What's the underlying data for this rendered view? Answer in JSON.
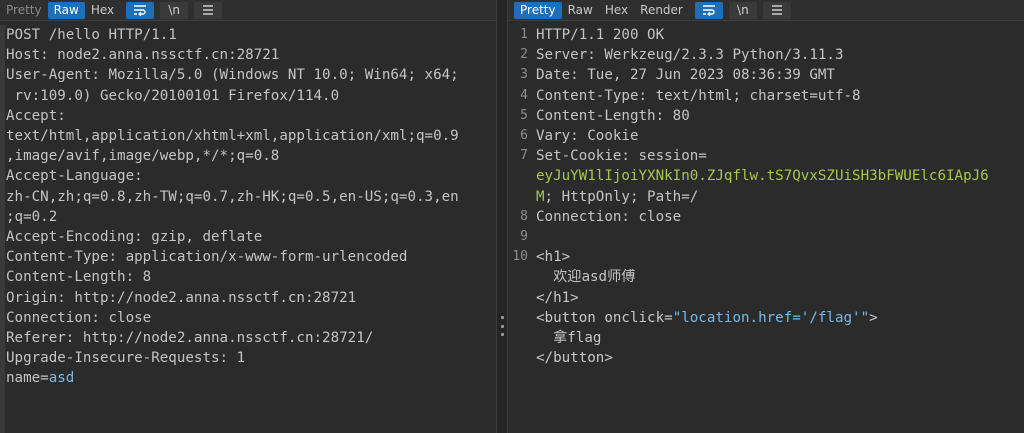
{
  "left": {
    "tabs": [
      "Pretty",
      "Raw",
      "Hex"
    ],
    "active_tab": "Raw",
    "lines": [
      "POST /hello HTTP/1.1",
      "Host: node2.anna.nssctf.cn:28721",
      "User-Agent: Mozilla/5.0 (Windows NT 10.0; Win64; x64;",
      " rv:109.0) Gecko/20100101 Firefox/114.0",
      "Accept:",
      "text/html,application/xhtml+xml,application/xml;q=0.9",
      ",image/avif,image/webp,*/*;q=0.8",
      "Accept-Language:",
      "zh-CN,zh;q=0.8,zh-TW;q=0.7,zh-HK;q=0.5,en-US;q=0.3,en",
      ";q=0.2",
      "Accept-Encoding: gzip, deflate",
      "Content-Type: application/x-www-form-urlencoded",
      "Content-Length: 8",
      "Origin: http://node2.anna.nssctf.cn:28721",
      "Connection: close",
      "Referer: http://node2.anna.nssctf.cn:28721/",
      "Upgrade-Insecure-Requests: 1",
      "",
      ""
    ],
    "body_key": "name=",
    "body_value": "asd"
  },
  "right": {
    "tabs": [
      "Pretty",
      "Raw",
      "Hex",
      "Render"
    ],
    "active_tab": "Pretty",
    "lines": [
      {
        "no": "1",
        "text": "HTTP/1.1 200 OK"
      },
      {
        "no": "2",
        "text": "Server: Werkzeug/2.3.3 Python/3.11.3"
      },
      {
        "no": "3",
        "text": "Date: Tue, 27 Jun 2023 08:36:39 GMT"
      },
      {
        "no": "4",
        "text": "Content-Type: text/html; charset=utf-8"
      },
      {
        "no": "5",
        "text": "Content-Length: 80"
      },
      {
        "no": "6",
        "text": "Vary: Cookie"
      }
    ],
    "cookie_label": "Set-Cookie: session=",
    "cookie_value_1": "eyJuYW1lIjoiYXNkIn0.ZJqflw.tS7QvxSZUiSH3bFWUElc6IApJ6",
    "cookie_value_2": "M",
    "cookie_rest": "; HttpOnly; Path=/",
    "line7_no": "7",
    "line8_no": "8",
    "line8_text": "Connection: close",
    "line9_no": "9",
    "line10_no": "10",
    "h1_open": "<h1>",
    "h1_text": "  欢迎asd师傅",
    "h1_close": "</h1>",
    "btn_open_a": "<button ",
    "btn_attr": "onclick=",
    "btn_val": "\"location.href='/flag'\"",
    "btn_open_b": ">",
    "btn_text": "  拿flag",
    "btn_close": "</button>"
  },
  "icons": {
    "wrap": "wrap-icon",
    "newline": "\\n",
    "menu": "menu-icon"
  }
}
